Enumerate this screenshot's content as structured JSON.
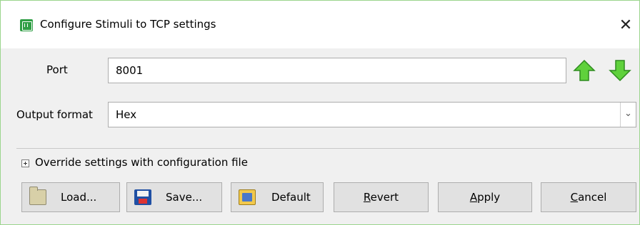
{
  "window": {
    "title": "Configure Stimuli to TCP settings",
    "close_glyph": "✕",
    "app_icon": "app-icon",
    "accent_border": "#9bd58d"
  },
  "form": {
    "port_label": "Port",
    "port_value": "8001",
    "output_format_label": "Output format",
    "output_format_value": "Hex",
    "up_arrow_icon": "green-up-arrow-icon",
    "down_arrow_icon": "green-down-arrow-icon",
    "arrow_color": "#3cb521"
  },
  "override": {
    "label": "Override settings with configuration file"
  },
  "buttons": {
    "load": "Load...",
    "save": "Save...",
    "default": "Default",
    "revert_first": "R",
    "revert_rest": "evert",
    "apply_first": "A",
    "apply_rest": "pply",
    "cancel_first": "C",
    "cancel_rest": "ancel"
  }
}
